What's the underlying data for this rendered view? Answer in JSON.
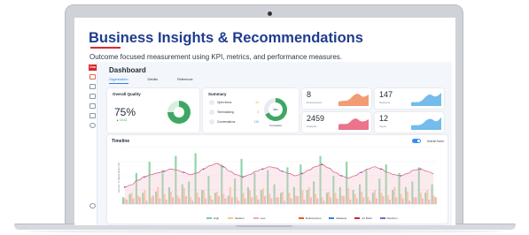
{
  "slide": {
    "title": "Business Insights & Recommendations",
    "subtitle": "Outcome focused measurement using KPI, metrics, and performance measures."
  },
  "app": {
    "logo": "Dna",
    "dashboard_title": "Dashboard",
    "tabs": [
      {
        "label": "Organization",
        "active": true
      },
      {
        "label": "Details",
        "active": false
      },
      {
        "label": "Reference",
        "active": false
      }
    ],
    "sidebar_icons": [
      "chart-icon",
      "list-icon",
      "flow-icon",
      "org-icon",
      "folder-icon",
      "search-icon",
      "settings-icon"
    ]
  },
  "overall_quality": {
    "label": "Overall Quality",
    "value": "75%",
    "delta": "▲ 10.13",
    "donut_fraction": 0.75
  },
  "summary": {
    "label": "Summary",
    "rows": [
      {
        "name": "Open items",
        "value": "24",
        "color": "#e8a33a"
      },
      {
        "name": "Terminalizing",
        "value": "8",
        "color": "#e8a33a"
      },
      {
        "name": "Conversations",
        "value": "12k",
        "color": "#3a8ef0"
      }
    ],
    "ring_label": "68%",
    "ring_fraction": 0.68,
    "ring_caption": "Completed"
  },
  "stats": [
    {
      "value": "8",
      "label": "Deliverances",
      "color": "#f08a5d"
    },
    {
      "value": "147",
      "label": "Sessions",
      "color": "#5ab0e8"
    },
    {
      "value": "2459",
      "label": "Analysis",
      "color": "#e85a78"
    },
    {
      "value": "12",
      "label": "Types",
      "color": "#5ab0e8"
    }
  ],
  "timeline": {
    "title": "Timeline",
    "toggle_label": "Overall Score",
    "toggle_on": true,
    "y_axis_title": "Number of deliverables (%)",
    "legend_left": [
      {
        "label": "High",
        "color": "#7ccf9a"
      },
      {
        "label": "Medium",
        "color": "#f6c58e"
      },
      {
        "label": "Low",
        "color": "#f2a7b8"
      }
    ],
    "legend_right": [
      {
        "label": "Deliverances",
        "color": "#e85a2a"
      },
      {
        "label": "Datasets",
        "color": "#2f80ed"
      },
      {
        "label": "Art Build",
        "color": "#d6243a"
      },
      {
        "label": "Direction",
        "color": "#7b61c8"
      }
    ]
  },
  "chart_data": {
    "type": "bar",
    "title": "Timeline",
    "ylabel": "Number of deliverables (%)",
    "ylim": [
      0,
      100
    ],
    "x": [
      1,
      2,
      3,
      4,
      5,
      6,
      7,
      8,
      9,
      10,
      11,
      12,
      13,
      14,
      15,
      16,
      17,
      18,
      19,
      20,
      21,
      22,
      23,
      24,
      25,
      26,
      27,
      28,
      29,
      30,
      31,
      32,
      33,
      34,
      35,
      36,
      37,
      38,
      39,
      40,
      41,
      42,
      43,
      44,
      45,
      46,
      47,
      48
    ],
    "series": [
      {
        "name": "High",
        "values": [
          12,
          18,
          55,
          20,
          75,
          22,
          60,
          30,
          85,
          35,
          40,
          90,
          25,
          50,
          20,
          70,
          15,
          45,
          80,
          30,
          55,
          25,
          60,
          35,
          20,
          65,
          30,
          70,
          25,
          40,
          85,
          20,
          50,
          30,
          75,
          25,
          35,
          60,
          20,
          45,
          70,
          25,
          55,
          30,
          40,
          65,
          20,
          35
        ]
      },
      {
        "name": "Medium",
        "values": [
          10,
          20,
          15,
          25,
          12,
          30,
          18,
          22,
          15,
          28,
          12,
          20,
          25,
          15,
          22,
          18,
          30,
          12,
          20,
          25,
          15,
          28,
          18,
          12,
          22,
          20,
          15,
          25,
          30,
          18,
          12,
          22,
          20,
          15,
          28,
          18,
          22,
          12,
          25,
          20,
          15,
          30,
          18,
          22,
          12,
          20,
          25,
          15
        ]
      },
      {
        "name": "Low",
        "values": [
          8,
          10,
          12,
          6,
          15,
          10,
          8,
          12,
          10,
          14,
          6,
          12,
          10,
          8,
          14,
          10,
          12,
          6,
          10,
          12,
          8,
          14,
          10,
          12,
          6,
          10,
          14,
          8,
          12,
          10,
          6,
          12,
          10,
          14,
          8,
          10,
          12,
          6,
          10,
          14,
          8,
          12,
          10,
          6,
          12,
          10,
          8,
          12
        ]
      },
      {
        "name": "Overall Score",
        "values": [
          30,
          34,
          42,
          48,
          52,
          55,
          58,
          62,
          60,
          56,
          52,
          55,
          62,
          68,
          72,
          66,
          58,
          52,
          48,
          52,
          58,
          62,
          66,
          64,
          58,
          54,
          50,
          54,
          60,
          66,
          70,
          64,
          56,
          50,
          46,
          50,
          56,
          62,
          66,
          62,
          56,
          52,
          50,
          54,
          60,
          62,
          58,
          54
        ]
      }
    ]
  }
}
